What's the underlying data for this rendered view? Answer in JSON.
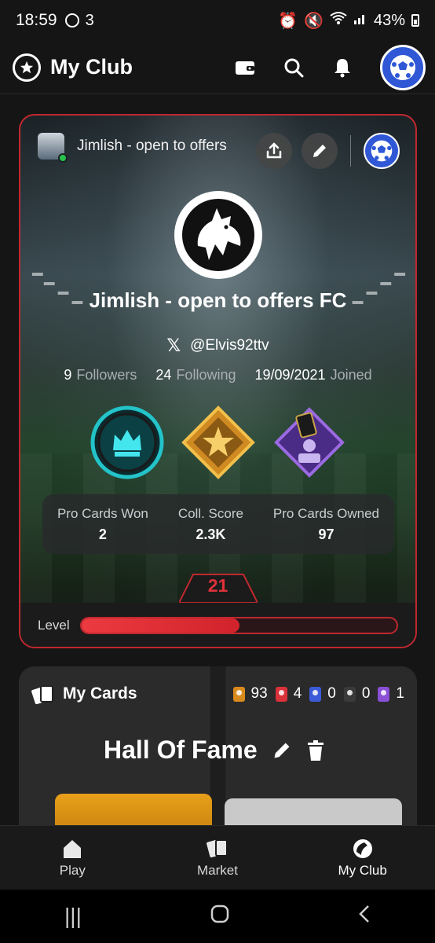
{
  "status_bar": {
    "time": "18:59",
    "carrier": "3",
    "battery": "43%"
  },
  "header": {
    "title": "My Club"
  },
  "club": {
    "owner_name": "Jimlish - open to offers",
    "name": "Jimlish - open to offers FC",
    "twitter_handle": "@Elvis92ttv",
    "followers": "9",
    "followers_label": "Followers",
    "following": "24",
    "following_label": "Following",
    "joined": "19/09/2021",
    "joined_label": "Joined",
    "metrics": [
      {
        "label": "Pro Cards Won",
        "value": "2"
      },
      {
        "label": "Coll. Score",
        "value": "2.3K"
      },
      {
        "label": "Pro Cards Owned",
        "value": "97"
      }
    ],
    "level": "21",
    "level_label": "Level",
    "level_progress": 0.5
  },
  "cards": {
    "title": "My Cards",
    "counts": [
      {
        "color": "#d88a1d",
        "value": "93"
      },
      {
        "color": "#d9323a",
        "value": "4"
      },
      {
        "color": "#3c5bd8",
        "value": "0"
      },
      {
        "color": "#3a3a3a",
        "value": "0"
      },
      {
        "color": "#8a4fd6",
        "value": "1"
      }
    ],
    "hall_title": "Hall Of Fame"
  },
  "nav": {
    "play": "Play",
    "market": "Market",
    "my_club": "My Club"
  }
}
